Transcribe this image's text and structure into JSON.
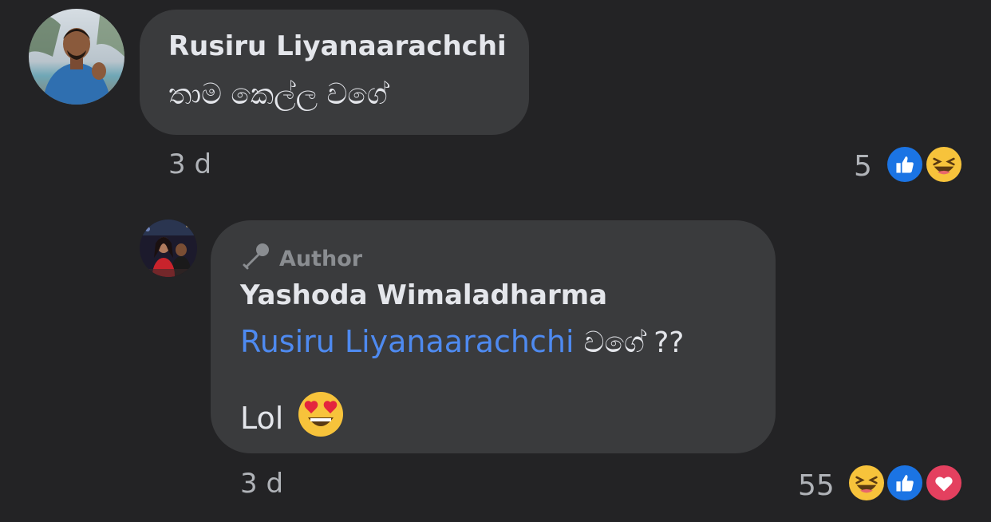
{
  "comment": {
    "author_name": "Rusiru Liyanaarachchi",
    "text": "තාම කෙල්ල වගේ",
    "timestamp": "3 d",
    "reaction_count": "5",
    "reactions": [
      "like-icon",
      "haha-icon"
    ]
  },
  "reply": {
    "badge_label": "Author",
    "author_name": "Yashoda Wimaladharma",
    "mention": "Rusiru Liyanaarachchi",
    "mention_suffix": "වගේ ??",
    "text": "Lol",
    "emoji": "heart-eyes-emoji",
    "timestamp": "3 d",
    "reaction_count": "55",
    "reactions": [
      "haha-icon",
      "like-icon",
      "love-icon"
    ]
  },
  "colors": {
    "background": "#232325",
    "bubble": "#3a3b3d",
    "mention": "#4e8af0",
    "like": "#1b74e4",
    "love": "#e4405f",
    "haha": "#f7c33b"
  }
}
